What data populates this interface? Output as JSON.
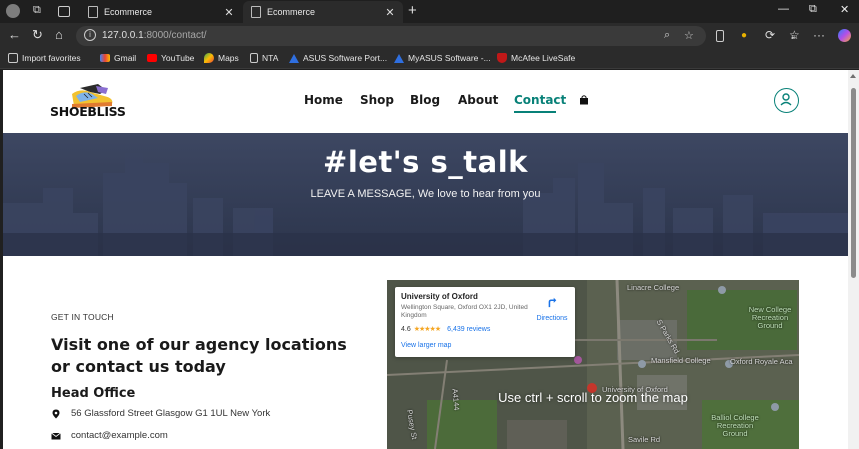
{
  "browser": {
    "tabs": [
      {
        "title": "Ecommerce",
        "active": false
      },
      {
        "title": "Ecommerce",
        "active": true
      }
    ],
    "url_host": "127.0.0.1",
    "url_path": ":8000/contact/",
    "bookmarks": [
      {
        "label": "Import favorites",
        "icon": "import-icon"
      },
      {
        "label": "Gmail",
        "icon": "gmail-icon"
      },
      {
        "label": "YouTube",
        "icon": "youtube-icon"
      },
      {
        "label": "Maps",
        "icon": "maps-icon"
      },
      {
        "label": "NTA",
        "icon": "document-icon"
      },
      {
        "label": "ASUS Software Port...",
        "icon": "asus-icon"
      },
      {
        "label": "MyASUS Software -...",
        "icon": "asus-icon"
      },
      {
        "label": "McAfee LiveSafe",
        "icon": "mcafee-icon"
      }
    ]
  },
  "site": {
    "logo_text": "SHOEBLISS",
    "nav": [
      {
        "label": "Home",
        "active": false
      },
      {
        "label": "Shop",
        "active": false
      },
      {
        "label": "Blog",
        "active": false
      },
      {
        "label": "About",
        "active": false
      },
      {
        "label": "Contact",
        "active": true
      }
    ],
    "accent": "#088178"
  },
  "hero": {
    "title": "#let's s_talk",
    "subtitle": "LEAVE A MESSAGE, We love to hear from you"
  },
  "contact": {
    "eyebrow": "GET IN TOUCH",
    "heading": "Visit one of our agency locations or contact us today",
    "office_title": "Head Office",
    "address": "56 Glassford Street Glasgow G1 1UL New York",
    "email": "contact@example.com"
  },
  "map": {
    "place_name": "University of Oxford",
    "place_address": "Wellington Square, Oxford OX1 2JD, United Kingdom",
    "rating": "4.6",
    "reviews": "6,439 reviews",
    "larger_map": "View larger map",
    "directions": "Directions",
    "overlay_hint": "Use ctrl + scroll to zoom the map",
    "labels": {
      "linacre": "Linacre College",
      "new_college_ground": "New College Recreation Ground",
      "mansfield": "Mansfield College",
      "oxford_royale": "Oxford Royale Aca",
      "univ": "University of Oxford",
      "balliol": "Balliol College Recreation Ground",
      "savile": "Savile Rd",
      "parks": "S Parks Rd",
      "pusey": "Pusey St",
      "a4144": "A4144"
    }
  }
}
